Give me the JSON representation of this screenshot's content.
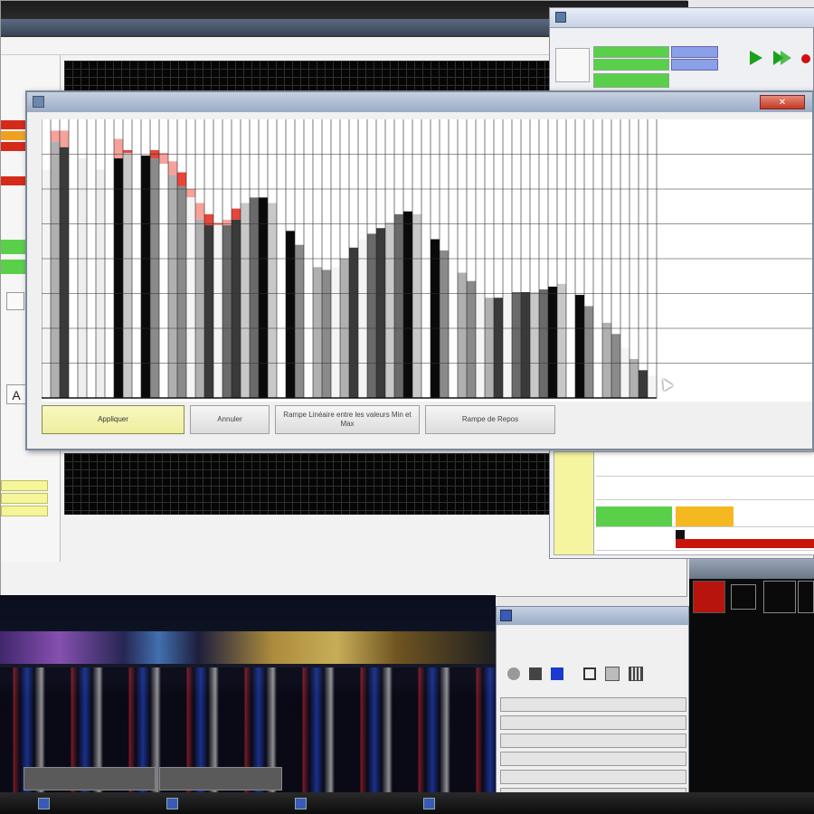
{
  "dialog": {
    "buttons": {
      "apply": "Appliquer",
      "cancel": "Annuler",
      "linear_ramp": "Rampe Linéaire entre les valeurs Min et Max",
      "draw_ramp": "Rampe de Repos"
    }
  },
  "colors": {
    "ramp_red": "#e8453a",
    "ramp_light_red": "#f6a29a",
    "bar_dark": "#3a3a3a",
    "bar_black": "#0a0a0a",
    "button_yellow": "#f0f0a8",
    "controller_green": "#5ad04a",
    "controller_blue": "#8aa0e8",
    "status_orange": "#f5b820",
    "status_red": "#c8140a"
  },
  "controller": {
    "play_icon": "play-icon",
    "step_icon": "step-icon",
    "record_icon": "record-icon"
  },
  "photo_window": {
    "toolbar_icons": [
      "circle-icon",
      "square-icon",
      "blue-square-icon",
      "monitor-icon",
      "copy-icon",
      "grid-icon"
    ]
  },
  "swatches": [
    "#b8140e",
    "#0a0a0a",
    "#0a0a0a",
    "#0a0a0a"
  ],
  "chart_data": {
    "type": "bar",
    "bar_count": 68,
    "ylim": [
      0,
      100
    ],
    "red_profile": [
      82,
      96,
      96,
      96,
      96,
      96,
      96,
      96,
      93,
      89,
      85,
      87,
      89,
      88,
      85,
      81,
      75,
      70,
      66,
      63,
      64,
      68,
      70,
      72,
      72,
      70,
      66,
      60,
      55,
      51,
      47,
      46,
      47,
      50,
      54,
      57,
      59,
      61,
      63,
      66,
      67,
      66,
      62,
      57,
      53,
      49,
      45,
      42,
      38,
      36,
      36,
      37,
      38,
      38,
      38,
      39,
      40,
      41,
      40,
      37,
      33,
      30,
      27,
      23,
      18,
      14,
      10,
      8
    ],
    "gray_profile": [
      88,
      92,
      90,
      88,
      86,
      84,
      82,
      84,
      86,
      88,
      89,
      88,
      86,
      84,
      80,
      76,
      72,
      64,
      62,
      62,
      62,
      64,
      70,
      72,
      72,
      70,
      66,
      60,
      55,
      51,
      47,
      46,
      47,
      50,
      54,
      57,
      59,
      61,
      63,
      66,
      67,
      66,
      62,
      57,
      53,
      49,
      45,
      42,
      38,
      36,
      36,
      37,
      38,
      38,
      38,
      39,
      40,
      41,
      40,
      37,
      33,
      30,
      27,
      23,
      18,
      14,
      10,
      8
    ],
    "highlight_bars": [
      3,
      4,
      5,
      6,
      7
    ]
  }
}
